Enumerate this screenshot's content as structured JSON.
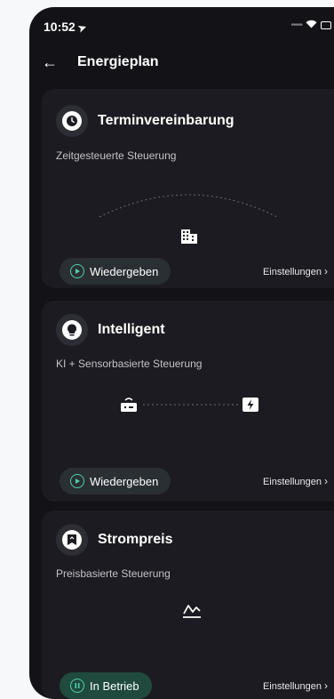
{
  "status_bar": {
    "time": "10:52"
  },
  "header": {
    "title": "Energieplan"
  },
  "cards": [
    {
      "title": "Terminvereinbarung",
      "subtitle": "Zeitgesteuerte Steuerung",
      "icon": "clock-icon",
      "button_label": "Wiedergeben",
      "settings_label": "Einstellungen"
    },
    {
      "title": "Intelligent",
      "subtitle": "KI + Sensorbasierte Steuerung",
      "icon": "bulb-icon",
      "button_label": "Wiedergeben",
      "settings_label": "Einstellungen"
    },
    {
      "title": "Strompreis",
      "subtitle": "Preisbasierte Steuerung",
      "icon": "price-tag-icon",
      "button_label": "In Betrieb",
      "settings_label": "Einstellungen"
    }
  ],
  "colors": {
    "accent": "#4fd1b0",
    "card": "#1b1b21",
    "background": "#121217"
  }
}
